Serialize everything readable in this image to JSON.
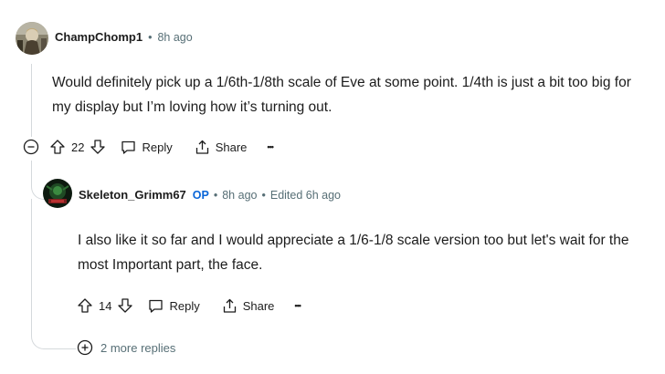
{
  "comment": {
    "username": "ChampChomp1",
    "time": "8h ago",
    "body": "Would definitely pick up a 1/6th-1/8th scale of Eve at some point. 1/4th is just a bit too big for my display but I’m loving how it’s turning out.",
    "votes": "22",
    "reply_label": "Reply",
    "share_label": "Share",
    "more_label": "•••"
  },
  "reply": {
    "username": "Skeleton_Grimm67",
    "op_badge": "OP",
    "time": "8h ago",
    "edited": "Edited 6h ago",
    "body": "I also like it so far and I would appreciate a 1/6-1/8 scale version too but let's wait for the most Important part, the face.",
    "votes": "14",
    "reply_label": "Reply",
    "share_label": "Share",
    "more_label": "•••"
  },
  "more_replies": "2 more replies",
  "bullet": "•"
}
